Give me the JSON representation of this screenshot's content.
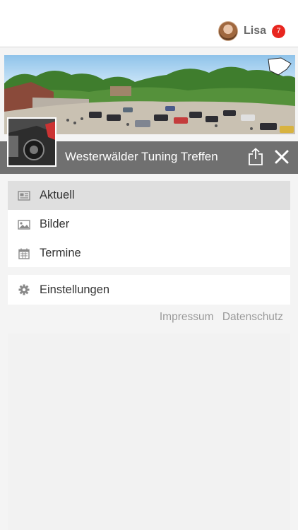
{
  "header": {
    "user_name": "Lisa",
    "notification_count": "7"
  },
  "group": {
    "title": "Westerwälder Tuning Treffen"
  },
  "menu": {
    "items": [
      {
        "label": "Aktuell",
        "icon": "newspaper-icon",
        "active": true
      },
      {
        "label": "Bilder",
        "icon": "image-icon",
        "active": false
      },
      {
        "label": "Termine",
        "icon": "calendar-icon",
        "active": false
      }
    ],
    "settings": {
      "label": "Einstellungen",
      "icon": "gear-icon"
    }
  },
  "footer": {
    "impressum": "Impressum",
    "datenschutz": "Datenschutz"
  },
  "colors": {
    "titlebar": "#707070",
    "badge": "#e8261f",
    "active_item": "#dfdfdf"
  }
}
